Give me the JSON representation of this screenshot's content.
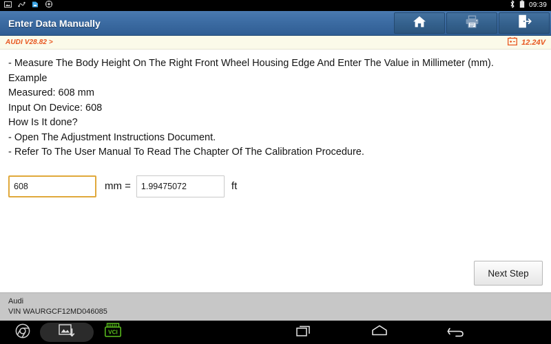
{
  "statusbar": {
    "left_icons": [
      "screenshot-icon",
      "usb-debug-icon",
      "sd-card-icon",
      "sync-icon"
    ],
    "bluetooth_icon": "bluetooth-icon",
    "battery_icon": "battery-icon",
    "clock": "09:39"
  },
  "titlebar": {
    "title": "Enter Data Manually",
    "buttons": [
      {
        "name": "home-button",
        "icon": "home-icon",
        "enabled": true
      },
      {
        "name": "print-button",
        "icon": "printer-icon",
        "enabled": false
      },
      {
        "name": "exit-button",
        "icon": "exit-icon",
        "enabled": true
      }
    ]
  },
  "substrip": {
    "version": "AUDI V28.82 >",
    "battery_icon": "car-battery-icon",
    "voltage": "12.24V",
    "accent_color": "#e8561f",
    "background_color": "#fbfae9"
  },
  "content": {
    "instructions": [
      "- Measure The Body Height On The Right Front Wheel Housing Edge And Enter The Value in Millimeter (mm).",
      "Example",
      "Measured: 608 mm",
      "Input On Device: 608",
      "How Is It done?",
      "- Open The Adjustment Instructions Document.",
      "- Refer To The User Manual To Read The Chapter Of The Calibration Procedure."
    ],
    "entry": {
      "mm_value": "608",
      "mm_placeholder": "",
      "mm_unit_label": "mm =",
      "ft_value": "1.99475072",
      "ft_placeholder": "",
      "ft_unit_label": "ft",
      "focus_border_color": "#e0a83a"
    },
    "next_step_label": "Next Step"
  },
  "vehicle_footer": {
    "make": "Audi",
    "vin": "VIN WAURGCF12MD046085"
  },
  "navbar": {
    "browser_icon": "chrome-icon",
    "capture_icon": "screenshot-capture-icon",
    "vci_icon": "vci-connector-icon",
    "vci_label": "VCI",
    "vci_color": "#5cc21e",
    "recents_icon": "recent-apps-icon",
    "home_icon": "android-home-icon",
    "back_icon": "android-back-icon"
  }
}
